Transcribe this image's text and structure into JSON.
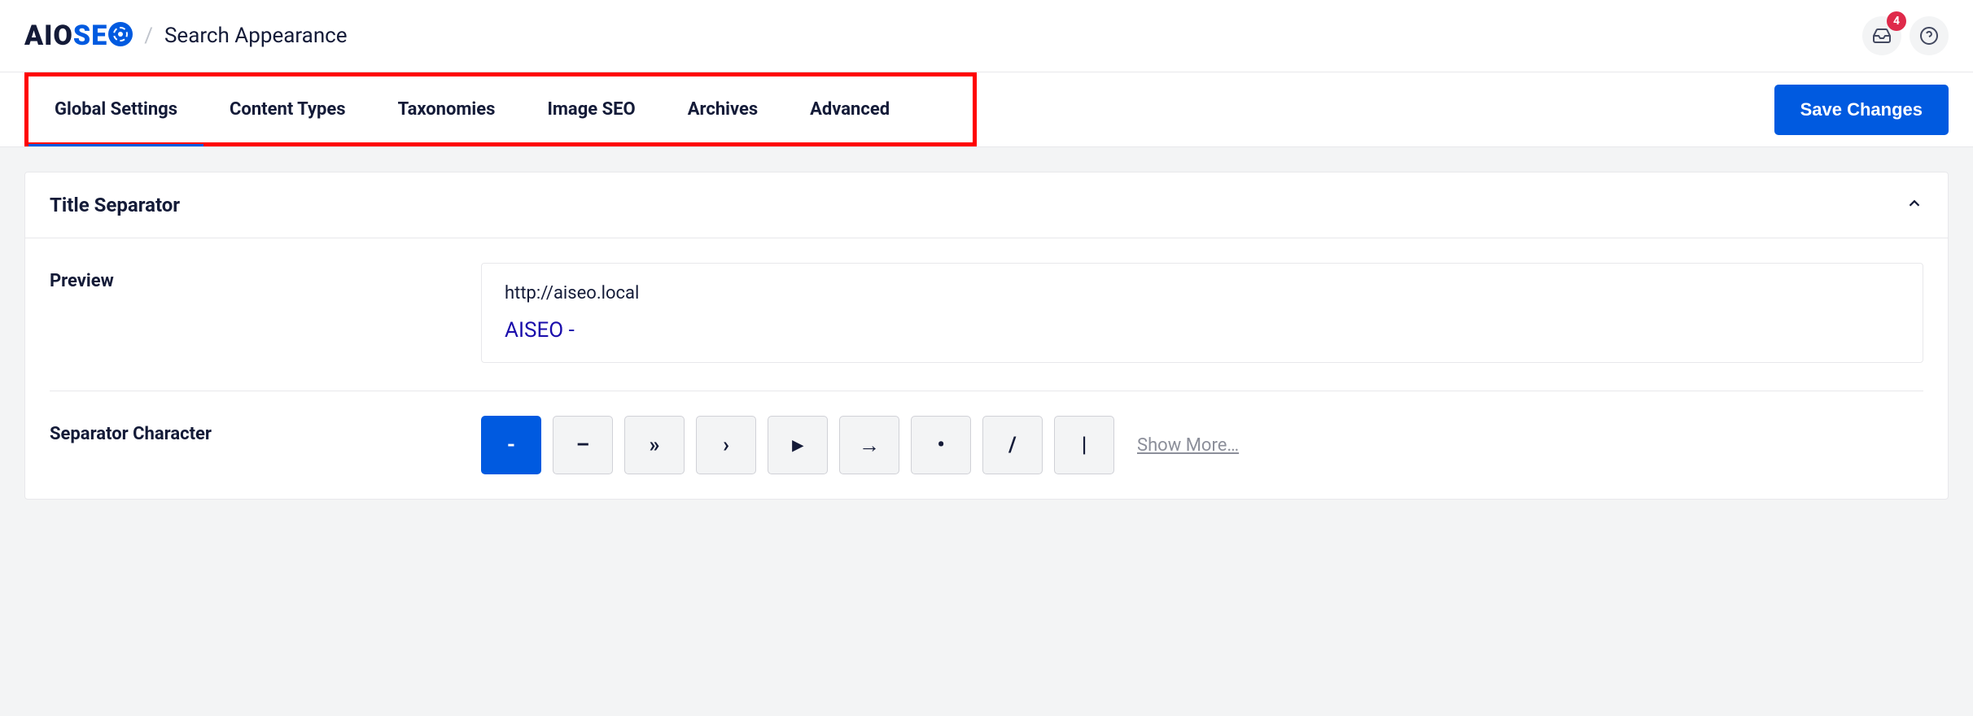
{
  "header": {
    "logo_aio": "AIO",
    "logo_se": "SE",
    "page_title": "Search Appearance",
    "notification_count": "4"
  },
  "tabs": [
    {
      "label": "Global Settings",
      "active": true
    },
    {
      "label": "Content Types",
      "active": false
    },
    {
      "label": "Taxonomies",
      "active": false
    },
    {
      "label": "Image SEO",
      "active": false
    },
    {
      "label": "Archives",
      "active": false
    },
    {
      "label": "Advanced",
      "active": false
    }
  ],
  "actions": {
    "save_label": "Save Changes"
  },
  "card": {
    "title": "Title Separator",
    "sections": {
      "preview": {
        "label": "Preview",
        "url": "http://aiseo.local",
        "title_preview": "AISEO -"
      },
      "separator": {
        "label": "Separator Character",
        "options": [
          {
            "char": "-",
            "active": true
          },
          {
            "char": "–",
            "active": false
          },
          {
            "char": "»",
            "active": false
          },
          {
            "char": "›",
            "active": false
          },
          {
            "char": "▸",
            "active": false
          },
          {
            "char": "→",
            "active": false
          },
          {
            "char": "•",
            "active": false
          },
          {
            "char": "/",
            "active": false
          },
          {
            "char": "|",
            "active": false
          }
        ],
        "show_more": "Show More…"
      }
    }
  }
}
